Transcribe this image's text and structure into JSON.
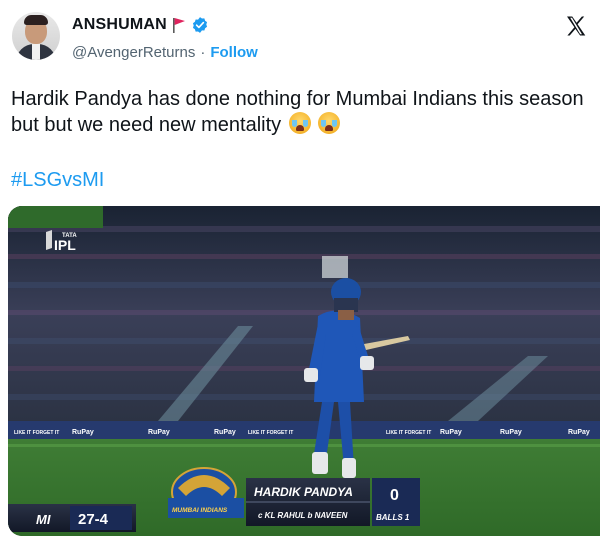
{
  "user": {
    "display_name": "ANSHUMAN",
    "handle": "@AvengerReturns",
    "separator": "·",
    "follow_label": "Follow"
  },
  "tweet": {
    "text": "Hardik Pandya has done nothing for Mumbai Indians this season but but we need new mentality",
    "hashtag": "#LSGvsMI"
  },
  "media": {
    "league_logo_text": "IPL",
    "league_sponsor": "TATA",
    "board_brand": "RuPay",
    "board_tagline": "LIKE IT FORGET IT",
    "batter_name": "HARDIK  PANDYA",
    "dismissal": "c KL RAHUL  b NAVEEN",
    "runs": "0",
    "balls": "BALLS 1",
    "team": "MI",
    "score": "27-4",
    "team_badge": "MUMBAI INDIANS"
  },
  "colors": {
    "link": "#1d9bf0",
    "text": "#0f1419",
    "muted": "#536471",
    "mi_blue": "#1b4fa3",
    "pitch_green": "#3e7a34"
  },
  "icons": [
    "red-flag-icon",
    "verified-badge-icon",
    "x-logo-icon",
    "loudly-crying-face-emoji"
  ]
}
